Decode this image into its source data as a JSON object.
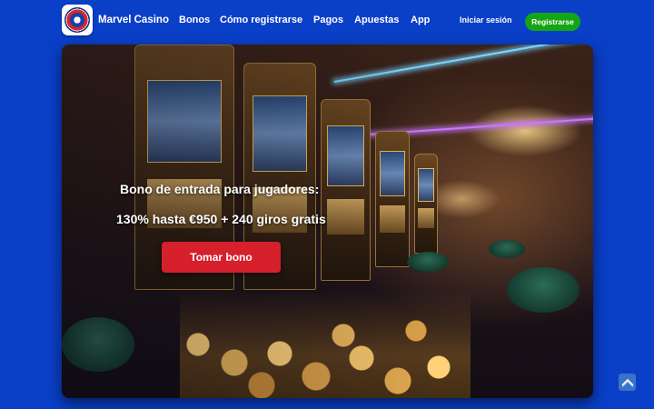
{
  "brand": {
    "name": "Marvel Casino"
  },
  "nav": {
    "items": [
      {
        "label": "Bonos"
      },
      {
        "label": "Cómo registrarse"
      },
      {
        "label": "Pagos"
      },
      {
        "label": "Apuestas"
      },
      {
        "label": "App"
      }
    ]
  },
  "auth": {
    "login_label": "Iniciar sesión",
    "register_label": "Registrarse"
  },
  "hero": {
    "title": "Bono de entrada para jugadores:",
    "subtitle": "130% hasta €950 + 240 giros gratis",
    "cta_label": "Tomar bono"
  },
  "icons": {
    "logo": "roulette-logo-icon",
    "scroll_top": "chevron-up-icon"
  },
  "colors": {
    "page_bg": "#0a3fc8",
    "register_bg": "#14a514",
    "cta_bg": "#d6202b",
    "scroll_top_bg": "#3a73c8"
  }
}
